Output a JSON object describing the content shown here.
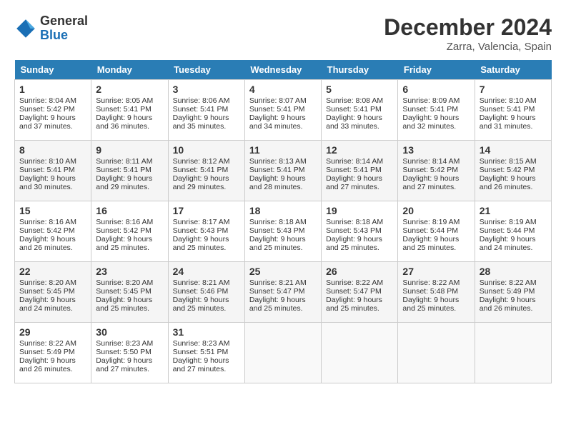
{
  "header": {
    "logo_line1": "General",
    "logo_line2": "Blue",
    "month": "December 2024",
    "location": "Zarra, Valencia, Spain"
  },
  "days_of_week": [
    "Sunday",
    "Monday",
    "Tuesday",
    "Wednesday",
    "Thursday",
    "Friday",
    "Saturday"
  ],
  "weeks": [
    [
      {
        "day": "1",
        "sunrise": "Sunrise: 8:04 AM",
        "sunset": "Sunset: 5:42 PM",
        "daylight": "Daylight: 9 hours and 37 minutes."
      },
      {
        "day": "2",
        "sunrise": "Sunrise: 8:05 AM",
        "sunset": "Sunset: 5:41 PM",
        "daylight": "Daylight: 9 hours and 36 minutes."
      },
      {
        "day": "3",
        "sunrise": "Sunrise: 8:06 AM",
        "sunset": "Sunset: 5:41 PM",
        "daylight": "Daylight: 9 hours and 35 minutes."
      },
      {
        "day": "4",
        "sunrise": "Sunrise: 8:07 AM",
        "sunset": "Sunset: 5:41 PM",
        "daylight": "Daylight: 9 hours and 34 minutes."
      },
      {
        "day": "5",
        "sunrise": "Sunrise: 8:08 AM",
        "sunset": "Sunset: 5:41 PM",
        "daylight": "Daylight: 9 hours and 33 minutes."
      },
      {
        "day": "6",
        "sunrise": "Sunrise: 8:09 AM",
        "sunset": "Sunset: 5:41 PM",
        "daylight": "Daylight: 9 hours and 32 minutes."
      },
      {
        "day": "7",
        "sunrise": "Sunrise: 8:10 AM",
        "sunset": "Sunset: 5:41 PM",
        "daylight": "Daylight: 9 hours and 31 minutes."
      }
    ],
    [
      {
        "day": "8",
        "sunrise": "Sunrise: 8:10 AM",
        "sunset": "Sunset: 5:41 PM",
        "daylight": "Daylight: 9 hours and 30 minutes."
      },
      {
        "day": "9",
        "sunrise": "Sunrise: 8:11 AM",
        "sunset": "Sunset: 5:41 PM",
        "daylight": "Daylight: 9 hours and 29 minutes."
      },
      {
        "day": "10",
        "sunrise": "Sunrise: 8:12 AM",
        "sunset": "Sunset: 5:41 PM",
        "daylight": "Daylight: 9 hours and 29 minutes."
      },
      {
        "day": "11",
        "sunrise": "Sunrise: 8:13 AM",
        "sunset": "Sunset: 5:41 PM",
        "daylight": "Daylight: 9 hours and 28 minutes."
      },
      {
        "day": "12",
        "sunrise": "Sunrise: 8:14 AM",
        "sunset": "Sunset: 5:41 PM",
        "daylight": "Daylight: 9 hours and 27 minutes."
      },
      {
        "day": "13",
        "sunrise": "Sunrise: 8:14 AM",
        "sunset": "Sunset: 5:42 PM",
        "daylight": "Daylight: 9 hours and 27 minutes."
      },
      {
        "day": "14",
        "sunrise": "Sunrise: 8:15 AM",
        "sunset": "Sunset: 5:42 PM",
        "daylight": "Daylight: 9 hours and 26 minutes."
      }
    ],
    [
      {
        "day": "15",
        "sunrise": "Sunrise: 8:16 AM",
        "sunset": "Sunset: 5:42 PM",
        "daylight": "Daylight: 9 hours and 26 minutes."
      },
      {
        "day": "16",
        "sunrise": "Sunrise: 8:16 AM",
        "sunset": "Sunset: 5:42 PM",
        "daylight": "Daylight: 9 hours and 25 minutes."
      },
      {
        "day": "17",
        "sunrise": "Sunrise: 8:17 AM",
        "sunset": "Sunset: 5:43 PM",
        "daylight": "Daylight: 9 hours and 25 minutes."
      },
      {
        "day": "18",
        "sunrise": "Sunrise: 8:18 AM",
        "sunset": "Sunset: 5:43 PM",
        "daylight": "Daylight: 9 hours and 25 minutes."
      },
      {
        "day": "19",
        "sunrise": "Sunrise: 8:18 AM",
        "sunset": "Sunset: 5:43 PM",
        "daylight": "Daylight: 9 hours and 25 minutes."
      },
      {
        "day": "20",
        "sunrise": "Sunrise: 8:19 AM",
        "sunset": "Sunset: 5:44 PM",
        "daylight": "Daylight: 9 hours and 25 minutes."
      },
      {
        "day": "21",
        "sunrise": "Sunrise: 8:19 AM",
        "sunset": "Sunset: 5:44 PM",
        "daylight": "Daylight: 9 hours and 24 minutes."
      }
    ],
    [
      {
        "day": "22",
        "sunrise": "Sunrise: 8:20 AM",
        "sunset": "Sunset: 5:45 PM",
        "daylight": "Daylight: 9 hours and 24 minutes."
      },
      {
        "day": "23",
        "sunrise": "Sunrise: 8:20 AM",
        "sunset": "Sunset: 5:45 PM",
        "daylight": "Daylight: 9 hours and 25 minutes."
      },
      {
        "day": "24",
        "sunrise": "Sunrise: 8:21 AM",
        "sunset": "Sunset: 5:46 PM",
        "daylight": "Daylight: 9 hours and 25 minutes."
      },
      {
        "day": "25",
        "sunrise": "Sunrise: 8:21 AM",
        "sunset": "Sunset: 5:47 PM",
        "daylight": "Daylight: 9 hours and 25 minutes."
      },
      {
        "day": "26",
        "sunrise": "Sunrise: 8:22 AM",
        "sunset": "Sunset: 5:47 PM",
        "daylight": "Daylight: 9 hours and 25 minutes."
      },
      {
        "day": "27",
        "sunrise": "Sunrise: 8:22 AM",
        "sunset": "Sunset: 5:48 PM",
        "daylight": "Daylight: 9 hours and 25 minutes."
      },
      {
        "day": "28",
        "sunrise": "Sunrise: 8:22 AM",
        "sunset": "Sunset: 5:49 PM",
        "daylight": "Daylight: 9 hours and 26 minutes."
      }
    ],
    [
      {
        "day": "29",
        "sunrise": "Sunrise: 8:22 AM",
        "sunset": "Sunset: 5:49 PM",
        "daylight": "Daylight: 9 hours and 26 minutes."
      },
      {
        "day": "30",
        "sunrise": "Sunrise: 8:23 AM",
        "sunset": "Sunset: 5:50 PM",
        "daylight": "Daylight: 9 hours and 27 minutes."
      },
      {
        "day": "31",
        "sunrise": "Sunrise: 8:23 AM",
        "sunset": "Sunset: 5:51 PM",
        "daylight": "Daylight: 9 hours and 27 minutes."
      },
      null,
      null,
      null,
      null
    ]
  ]
}
